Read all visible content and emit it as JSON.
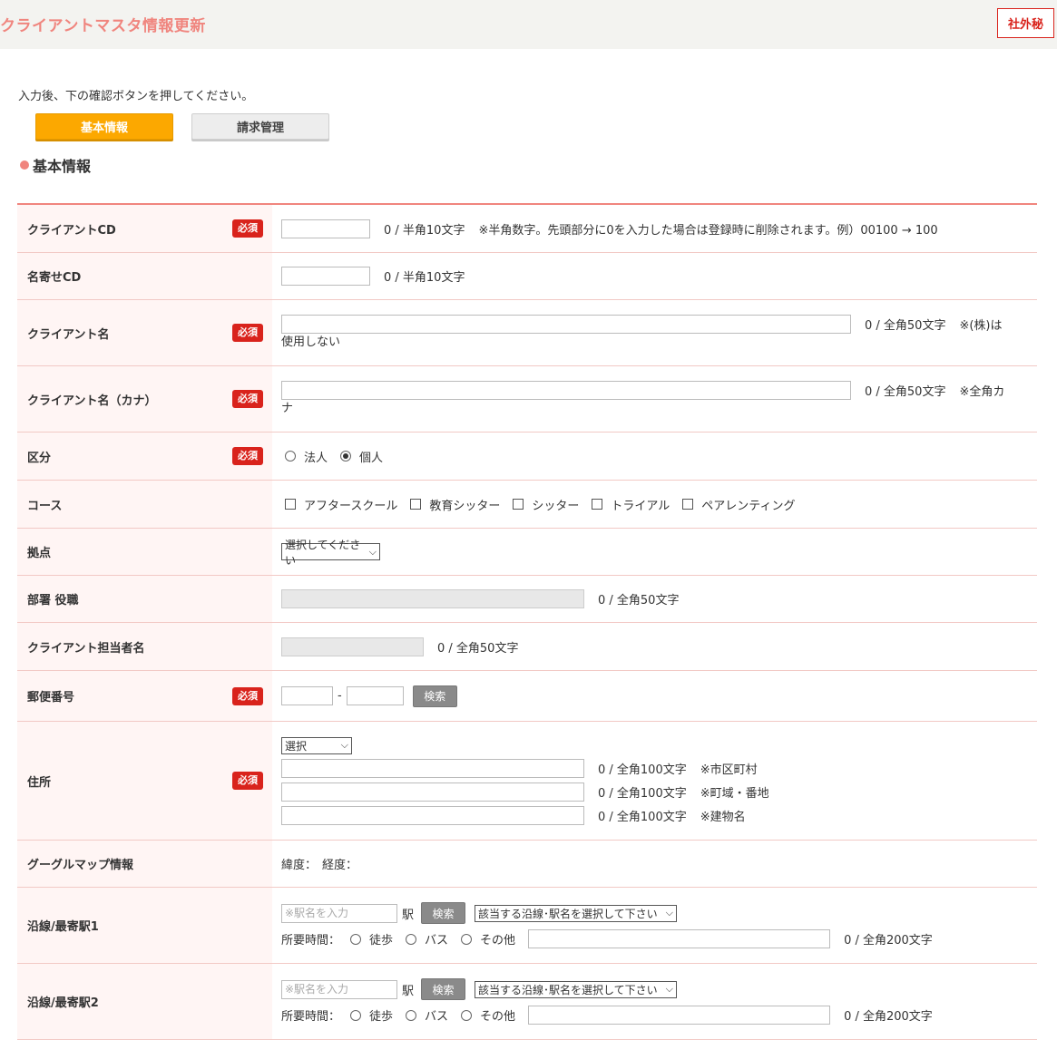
{
  "header": {
    "title": "クライアントマスタ情報更新",
    "confidential": "社外秘"
  },
  "instruction": "入力後、下の確認ボタンを押してください。",
  "tabs": [
    {
      "label": "基本情報",
      "active": true
    },
    {
      "label": "請求管理",
      "active": false
    }
  ],
  "section_title": "基本情報",
  "required_label": "必須",
  "rows": {
    "client_cd": {
      "label": "クライアントCD",
      "counter": "0 / 半角10文字",
      "note": "※半角数字。先頭部分に0を入力した場合は登録時に削除されます。例）00100 → 100"
    },
    "name_cd": {
      "label": "名寄せCD",
      "counter": "0 / 半角10文字"
    },
    "client_name": {
      "label": "クライアント名",
      "counter": "0 / 全角50文字",
      "note_a": "※(株)は",
      "note_b": "使用しない"
    },
    "client_kana": {
      "label": "クライアント名（カナ）",
      "counter": "0 / 全角50文字",
      "note_a": "※全角カ",
      "note_b": "ナ"
    },
    "category": {
      "label": "区分",
      "options": [
        "法人",
        "個人"
      ],
      "selected": "個人"
    },
    "course": {
      "label": "コース",
      "options": [
        "アフタースクール",
        "教育シッター",
        "シッター",
        "トライアル",
        "ペアレンティング"
      ]
    },
    "base": {
      "label": "拠点",
      "select_value": "選択してください"
    },
    "department": {
      "label": "部署 役職",
      "counter": "0 / 全角50文字"
    },
    "contact": {
      "label": "クライアント担当者名",
      "counter": "0 / 全角50文字"
    },
    "postal": {
      "label": "郵便番号",
      "separator": "-",
      "search": "検索"
    },
    "address": {
      "label": "住所",
      "pref_select": "選択",
      "lines": [
        {
          "counter": "0 / 全角100文字",
          "note": "※市区町村"
        },
        {
          "counter": "0 / 全角100文字",
          "note": "※町域・番地"
        },
        {
          "counter": "0 / 全角100文字",
          "note": "※建物名"
        }
      ]
    },
    "map": {
      "label": "グーグルマップ情報",
      "lat": "緯度：",
      "lng": "経度："
    },
    "station1": {
      "label": "沿線/最寄駅1"
    },
    "station2": {
      "label": "沿線/最寄駅2"
    }
  },
  "station": {
    "placeholder": "※駅名を入力",
    "suffix": "駅",
    "search": "検索",
    "select_value": "該当する沿線･駅名を選択して下さい",
    "time_label": "所要時間：",
    "modes": [
      "徒歩",
      "バス",
      "その他"
    ],
    "counter": "0 / 全角200文字"
  }
}
